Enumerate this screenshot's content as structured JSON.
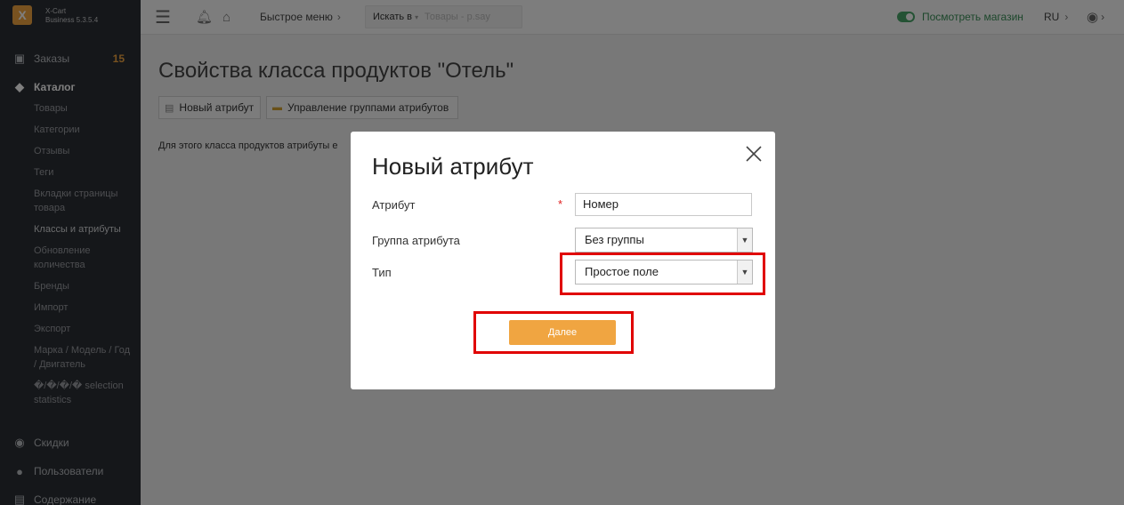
{
  "brand": {
    "logo_letter": "X",
    "line1": "X-Cart",
    "line2": "Business 5.3.5.4"
  },
  "sidebar": {
    "orders": {
      "label": "Заказы",
      "count": "15"
    },
    "catalog": {
      "label": "Каталог",
      "items": [
        "Товары",
        "Категории",
        "Отзывы",
        "Теги",
        "Вкладки страницы товара",
        "Классы и атрибуты",
        "Обновление количества",
        "Бренды",
        "Импорт",
        "Экспорт",
        "Марка / Модель / Год / Двигатель",
        "�/�/�/� selection statistics"
      ]
    },
    "discounts": "Скидки",
    "users": "Пользователи",
    "content": "Содержание"
  },
  "topbar": {
    "quick_menu": "Быстрое меню",
    "search_label": "Искать в",
    "search_placeholder": "Товары - p.say",
    "view_store": "Посмотреть магазин",
    "lang": "RU"
  },
  "page": {
    "title": "Свойства класса продуктов \"Отель\"",
    "btn_new_attr": "Новый атрибут",
    "btn_manage_groups": "Управление группами атрибутов",
    "info_text": "Для этого класса продуктов атрибуты е"
  },
  "modal": {
    "title": "Новый атрибут",
    "attr_label": "Атрибут",
    "required_mark": "*",
    "attr_value": "Номер",
    "group_label": "Группа атрибута",
    "group_value": "Без группы",
    "type_label": "Тип",
    "type_value": "Простое поле",
    "next_label": "Далее"
  },
  "colors": {
    "accent": "#f0a541",
    "highlight": "#e00000",
    "sidebar": "#2b2e34",
    "toggle": "#49a568"
  }
}
